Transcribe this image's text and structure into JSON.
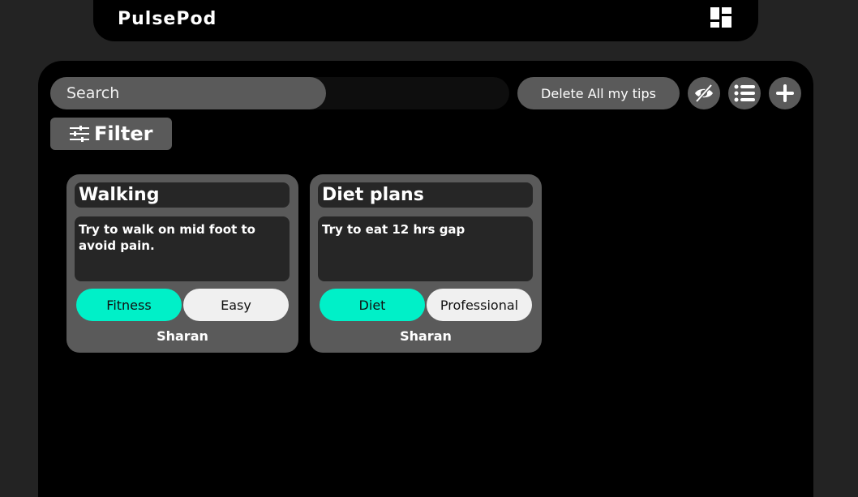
{
  "app": {
    "title": "PulsePod"
  },
  "toolbar": {
    "search_placeholder": "Search",
    "delete_label": "Delete All my tips",
    "filter_label": "Filter"
  },
  "tips": [
    {
      "title": "Walking",
      "body": "Try to walk on mid foot to avoid pain.",
      "category": "Fitness",
      "level": "Easy",
      "author": "Sharan"
    },
    {
      "title": "Diet plans",
      "body": "Try to eat 12 hrs gap",
      "category": "Diet",
      "level": "Professional",
      "author": "Sharan"
    }
  ],
  "colors": {
    "background": "#232323",
    "panel": "#000000",
    "control": "#5a5a5a",
    "accent": "#00f0c8",
    "tag_light": "#f0f0f0"
  },
  "icons": {
    "dashboard": "dashboard-icon",
    "hide": "eye-slash-icon",
    "list": "list-icon",
    "add": "plus-icon",
    "filter": "sliders-icon"
  }
}
